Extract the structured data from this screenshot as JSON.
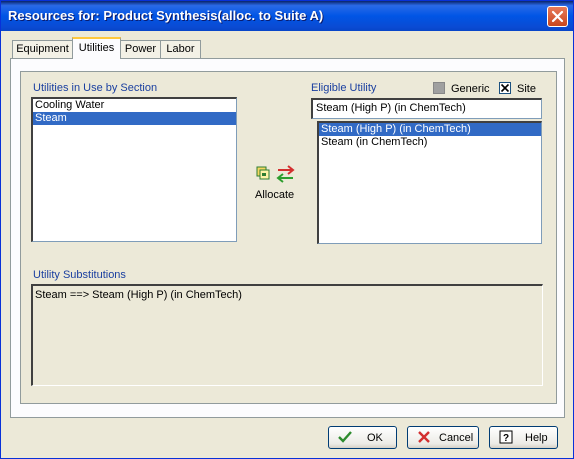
{
  "window": {
    "title": "Resources for: Product Synthesis(alloc. to Suite A)"
  },
  "tabs": [
    {
      "label": "Equipment",
      "active": false
    },
    {
      "label": "Utilities",
      "active": true
    },
    {
      "label": "Power",
      "active": false
    },
    {
      "label": "Labor",
      "active": false
    }
  ],
  "utilities_in_use": {
    "label": "Utilities in Use by Section",
    "items": [
      "Cooling Water",
      "Steam"
    ],
    "selected": "Steam"
  },
  "eligible_utility": {
    "label": "Eligible Utility",
    "value": "Steam (High P) (in ChemTech)",
    "items": [
      "Steam (High P) (in ChemTech)",
      "Steam (in ChemTech)"
    ],
    "selected": "Steam (High P) (in ChemTech)"
  },
  "filters": {
    "generic": {
      "label": "Generic",
      "checked": false,
      "enabled": false
    },
    "site": {
      "label": "Site",
      "checked": true,
      "enabled": true
    }
  },
  "allocate": {
    "label": "Allocate",
    "icon": "allocate-swap-icon"
  },
  "substitutions": {
    "label": "Utility Substitutions",
    "text": "Steam ==> Steam (High P) (in ChemTech)"
  },
  "buttons": {
    "ok": "OK",
    "cancel": "Cancel",
    "help": "Help"
  },
  "colors": {
    "title_bar": "#0055E5",
    "selection": "#316AC5",
    "label_blue": "#1A3FA0",
    "dialog_bg": "#ECE9D8"
  }
}
